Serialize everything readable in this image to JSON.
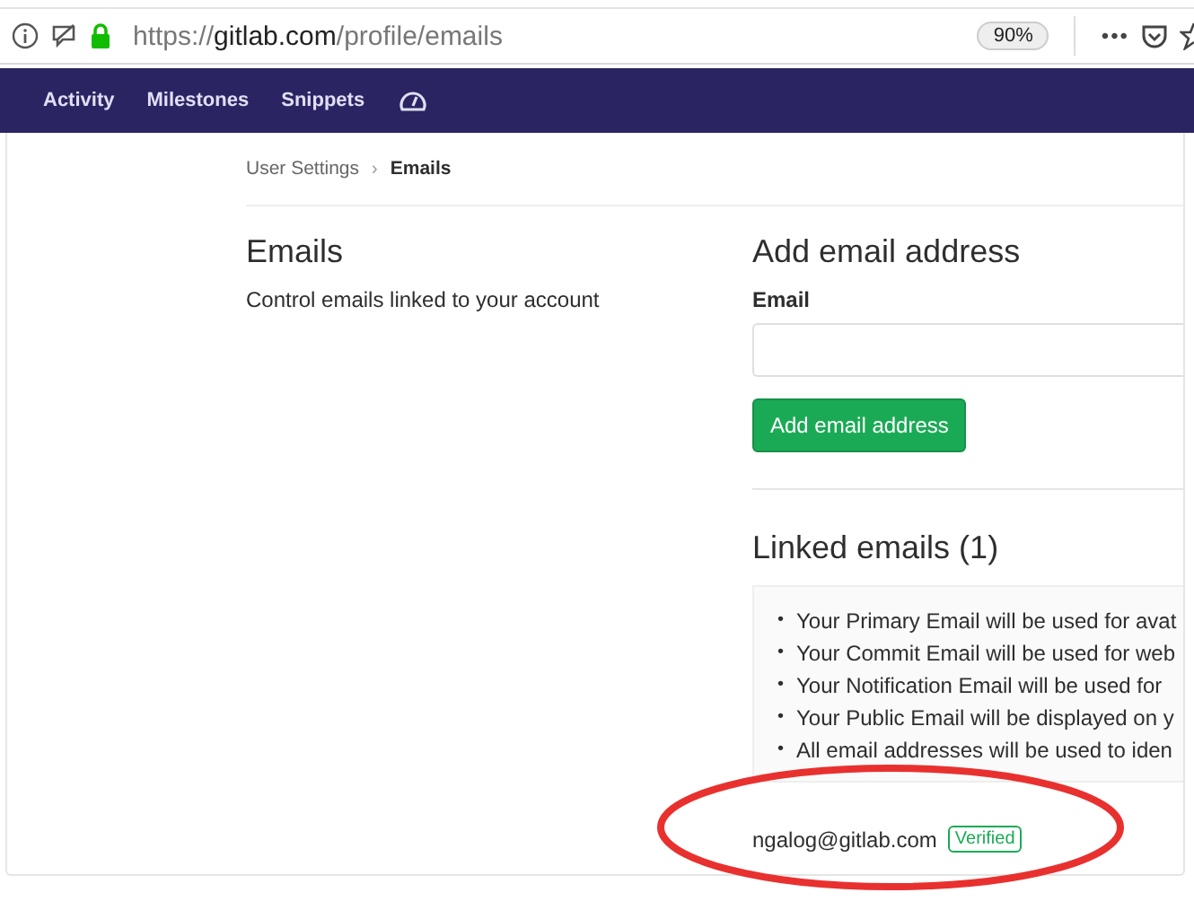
{
  "browser": {
    "url": {
      "scheme": "https://",
      "host": "gitlab.com",
      "path": "/profile/emails"
    },
    "zoom": "90%",
    "menu": "•••"
  },
  "nav": {
    "items": [
      {
        "label": "Activity"
      },
      {
        "label": "Milestones"
      },
      {
        "label": "Snippets"
      }
    ]
  },
  "breadcrumb": {
    "parent": "User Settings",
    "separator": "›",
    "current": "Emails"
  },
  "intro": {
    "title": "Emails",
    "description": "Control emails linked to your account"
  },
  "add_email": {
    "title": "Add email address",
    "label": "Email",
    "button": "Add email address"
  },
  "linked": {
    "title": "Linked emails (1)",
    "notes": [
      {
        "marker": "•",
        "text": "Your Primary Email will be used for avat"
      },
      {
        "marker": "•",
        "text": "Your Commit Email will be used for web"
      },
      {
        "marker": "•",
        "text": "Your Notification Email will be used for"
      },
      {
        "marker": "•",
        "text": "Your Public Email will be displayed on y"
      },
      {
        "marker": "•",
        "text": "All email addresses will be used to iden"
      }
    ],
    "emails": [
      {
        "address": "ngalog@gitlab.com",
        "badge": "Verified"
      }
    ]
  },
  "annotations": [
    {
      "kind": "ellipse",
      "color": "#e8312f"
    }
  ]
}
